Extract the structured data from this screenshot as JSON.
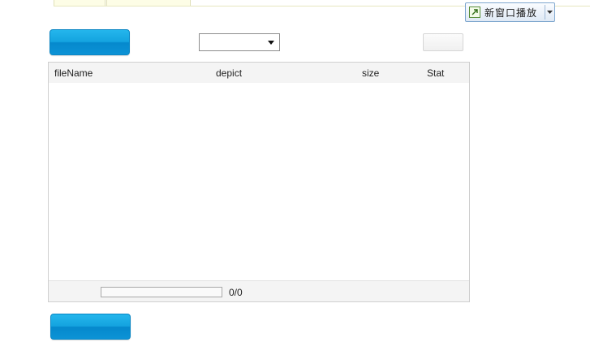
{
  "new_window": {
    "label": "新窗口播放"
  },
  "toolbar": {
    "select_value": ""
  },
  "table": {
    "columns": [
      "fileName",
      "depict",
      "size",
      "Stat"
    ],
    "rows": []
  },
  "footer": {
    "progress_fraction": 0,
    "progress_text": "0/0"
  },
  "colors": {
    "accent": "#14a3df",
    "panel_header": "#f4f4f4"
  }
}
